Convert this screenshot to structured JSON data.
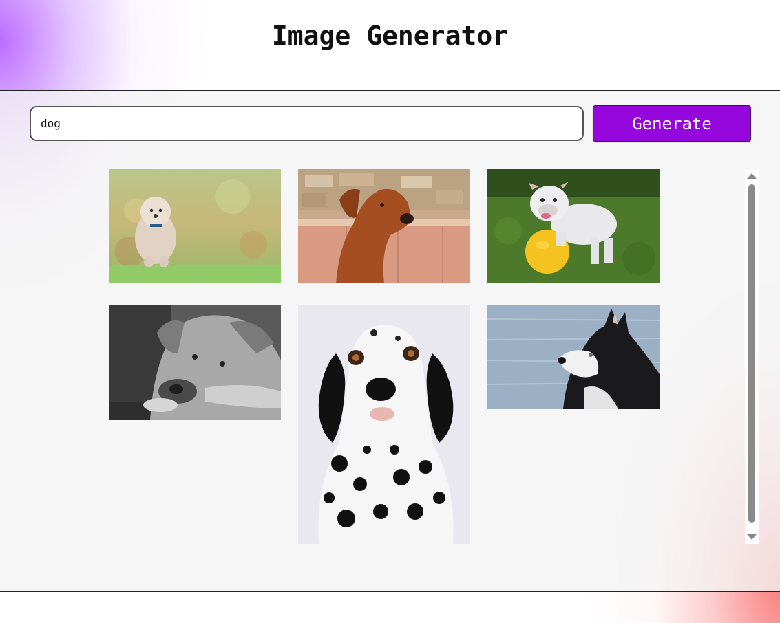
{
  "header": {
    "title": "Image Generator"
  },
  "search": {
    "value": "dog",
    "button_label": "Generate"
  },
  "gallery": {
    "images": [
      {
        "subject": "fluffy white dog running through autumn leaves"
      },
      {
        "subject": "brown rhodesian ridgeback dog in front of a stone wall"
      },
      {
        "subject": "white bulldog standing on a yellow ball in the grass"
      },
      {
        "subject": "black and white photo of a dog resting its head"
      },
      {
        "subject": "dalmatian dog portrait"
      },
      {
        "subject": "husky dog in front of water"
      }
    ]
  },
  "colors": {
    "accent": "#9406dc",
    "gradient_top_left": "#b964ff",
    "gradient_bottom_right": "#fa7878"
  }
}
